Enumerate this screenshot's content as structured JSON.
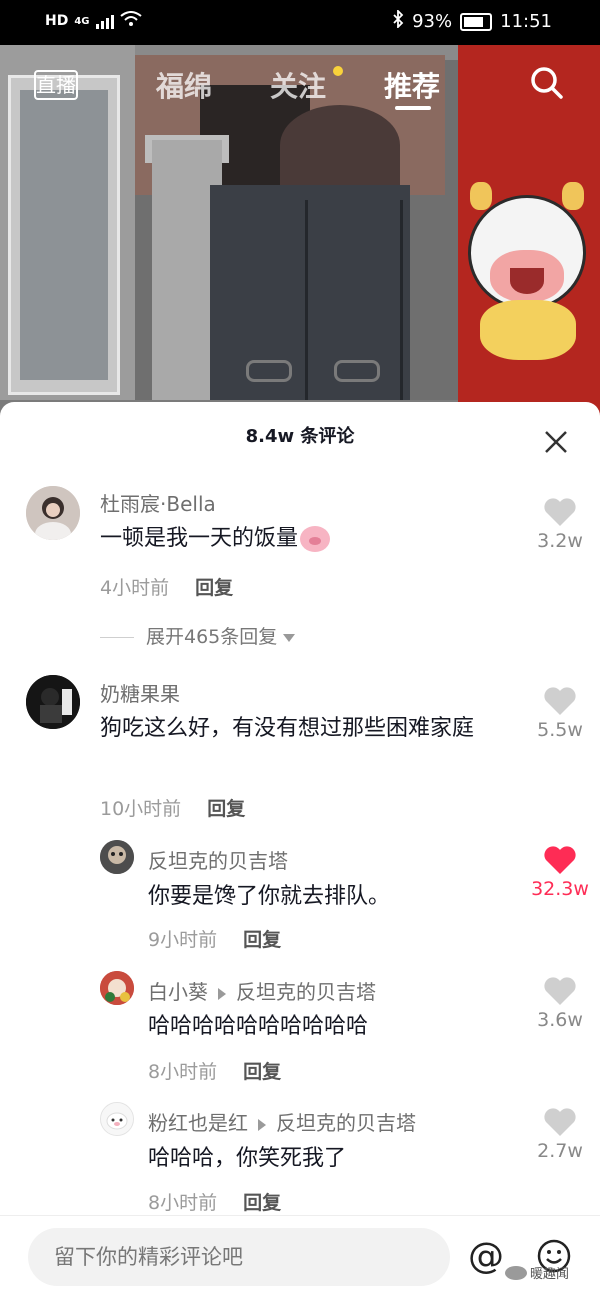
{
  "status_bar": {
    "hd": "HD",
    "network": "4G",
    "battery_pct": "93%",
    "time": "11:51"
  },
  "top_nav": {
    "live_label": "直播",
    "tabs": [
      {
        "label": "福绵"
      },
      {
        "label": "关注"
      },
      {
        "label": "推荐"
      }
    ],
    "active_tab": "推荐"
  },
  "comments_sheet": {
    "title": "8.4w 条评论",
    "comments": [
      {
        "user": "杜雨宸·Bella",
        "text": "一顿是我一天的饭量",
        "time": "4小时前",
        "reply": "回复",
        "likes": "3.2w",
        "expand": "展开465条回复"
      },
      {
        "user": "奶糖果果",
        "text": "狗吃这么好，有没有想过那些困难家庭",
        "time": "10小时前",
        "reply": "回复",
        "likes": "5.5w"
      }
    ],
    "replies": [
      {
        "user": "反坦克的贝吉塔",
        "text": "你要是馋了你就去排队。",
        "time": "9小时前",
        "reply": "回复",
        "likes": "32.3w",
        "liked": true
      },
      {
        "user": "白小葵",
        "reply_to": "反坦克的贝吉塔",
        "text": "哈哈哈哈哈哈哈哈哈哈",
        "time": "8小时前",
        "reply": "回复",
        "likes": "3.6w"
      },
      {
        "user": "粉红也是红",
        "reply_to": "反坦克的贝吉塔",
        "text": "哈哈哈，你笑死我了",
        "time": "8小时前",
        "reply": "回复",
        "likes": "2.7w"
      }
    ]
  },
  "input": {
    "placeholder": "留下你的精彩评论吧"
  },
  "watermark": "暖趣闻",
  "colors": {
    "like_red": "#fe2c55",
    "nav_dot": "#f9d23b"
  }
}
